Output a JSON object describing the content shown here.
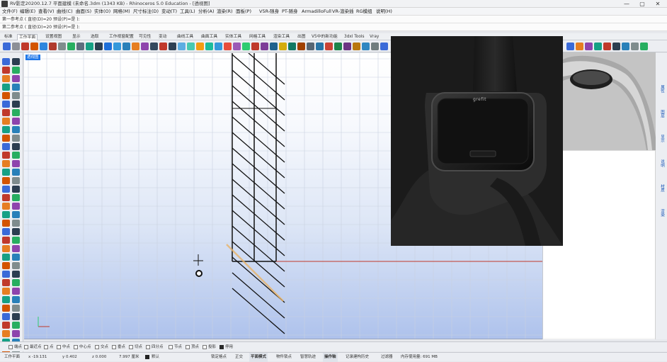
{
  "window": {
    "title": "RV影定20200.12.7 平面建模 (未命名.3dm (1343 KB) - Rhinoceros 5.0 Education - [透视图]",
    "minimize": "—",
    "maximize": "▢",
    "close": "✕"
  },
  "menu": [
    "文件(F)",
    "编辑(E)",
    "查看(V)",
    "曲线(C)",
    "曲面(S)",
    "实体(O)",
    "网格(M)",
    "尺寸标注(D)",
    "变动(T)",
    "工具(L)",
    "分析(A)",
    "渲染(R)",
    "面板(P)",
    "V5R-随身",
    "PT-随身",
    "ArmadilloFull",
    "VR-渲染插",
    "RG模组",
    "说明(H)"
  ],
  "command": {
    "line1": "第一参考点 ( 直径(D)=20 预设(P)=是 ):",
    "line2": "第二参考点 ( 直径(D)=20 预设(P)=是 ):"
  },
  "tabs": [
    "标准",
    "工作平面",
    "设置视图",
    "显示",
    "选取",
    "工作视窗配置",
    "可见性",
    "变动",
    "曲线工具",
    "曲面工具",
    "实体工具",
    "网格工具",
    "渲染工具",
    "出图",
    "V5中的新功能",
    "3dxl Tools",
    "Vray",
    "RhinoGold",
    "多边形建模",
    "VR-物体",
    "PT",
    "VR",
    "Mi"
  ],
  "active_tab_index": 1,
  "viewport": {
    "label": "透视图",
    "axis_x": "x",
    "axis_y": "y"
  },
  "osnaps": [
    {
      "label": "端点",
      "checked": false
    },
    {
      "label": "最近点",
      "checked": false
    },
    {
      "label": "点",
      "checked": false
    },
    {
      "label": "中点",
      "checked": false
    },
    {
      "label": "中心点",
      "checked": false
    },
    {
      "label": "交点",
      "checked": false
    },
    {
      "label": "垂点",
      "checked": false
    },
    {
      "label": "切点",
      "checked": false
    },
    {
      "label": "四分点",
      "checked": false
    },
    {
      "label": "节点",
      "checked": false
    },
    {
      "label": "顶点",
      "checked": false
    },
    {
      "label": "投影",
      "checked": false
    },
    {
      "label": "停用",
      "checked": true
    }
  ],
  "status": {
    "cplane": "工作平面",
    "x": "x -19.131",
    "y": "y 0.402",
    "z": "z 0.000",
    "units": "7.997 厘米",
    "layer": "默认",
    "grid_snap": "锁定格点",
    "ortho": "正交",
    "planar": "平面模式",
    "osnap": "物件锁点",
    "smarttrack": "智慧轨迹",
    "gumball": "操作轴",
    "history": "记录建构历史",
    "filter": "过滤器",
    "memory": "内存使用量: 691 MB"
  },
  "right_panel_tabs": [
    "属性",
    "图层",
    "显示",
    "说明",
    "材质",
    "渲染"
  ],
  "product": {
    "logo_text": "grefit"
  },
  "colors": {
    "viewport_top": "#ffffff",
    "viewport_bottom": "#aec2ec",
    "hatch": "#111111",
    "x_axis": "#c0392b",
    "highlight": "#e8b46a",
    "active_label": "#1d76e8"
  }
}
